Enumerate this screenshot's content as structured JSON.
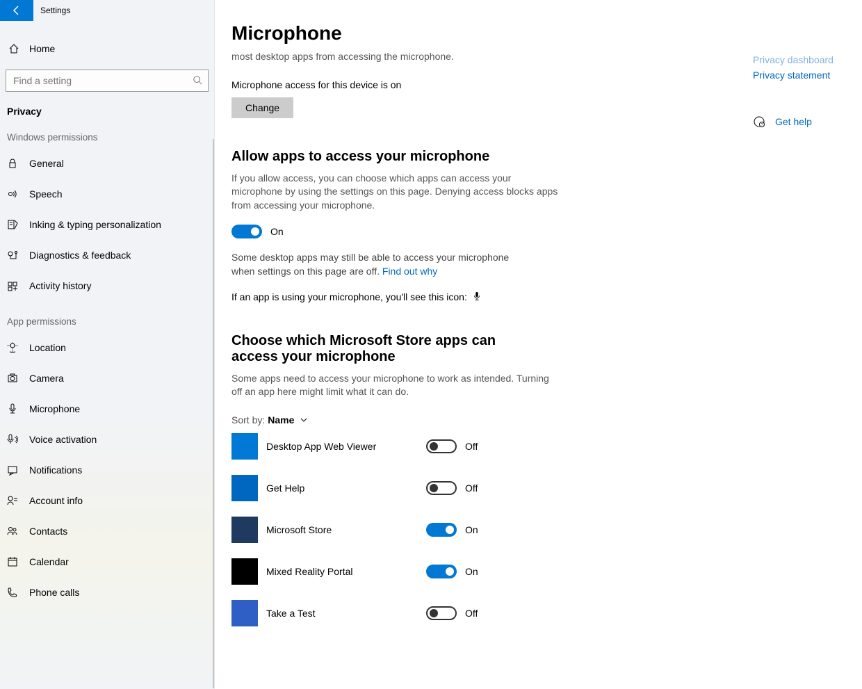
{
  "window": {
    "title": "Settings"
  },
  "sidebar": {
    "home": "Home",
    "search_placeholder": "Find a setting",
    "section": "Privacy",
    "group1": "Windows permissions",
    "group2": "App permissions",
    "items1": [
      {
        "label": "General"
      },
      {
        "label": "Speech"
      },
      {
        "label": "Inking & typing personalization"
      },
      {
        "label": "Diagnostics & feedback"
      },
      {
        "label": "Activity history"
      }
    ],
    "items2": [
      {
        "label": "Location"
      },
      {
        "label": "Camera"
      },
      {
        "label": "Microphone"
      },
      {
        "label": "Voice activation"
      },
      {
        "label": "Notifications"
      },
      {
        "label": "Account info"
      },
      {
        "label": "Contacts"
      },
      {
        "label": "Calendar"
      },
      {
        "label": "Phone calls"
      }
    ]
  },
  "page": {
    "title": "Microphone",
    "intro": "most desktop apps from accessing the microphone.",
    "device_status": "Microphone access for this device is on",
    "change_btn": "Change",
    "allow_heading": "Allow apps to access your microphone",
    "allow_desc": "If you allow access, you can choose which apps can access your microphone by using the settings on this page. Denying access blocks apps from accessing your microphone.",
    "allow_state": "On",
    "note1a": "Some desktop apps may still be able to access your microphone when settings on this page are off. ",
    "note1_link": "Find out why",
    "note2": "If an app is using your microphone, you'll see this icon:",
    "choose_heading": "Choose which Microsoft Store apps can access your microphone",
    "choose_desc": "Some apps need to access your microphone to work as intended. Turning off an app here might limit what it can do.",
    "sort_prefix": "Sort by:",
    "sort_value": "Name",
    "apps": [
      {
        "name": "Desktop App Web Viewer",
        "state": "Off",
        "on": false,
        "color": "#0078d4"
      },
      {
        "name": "Get Help",
        "state": "Off",
        "on": false,
        "color": "#0067c0"
      },
      {
        "name": "Microsoft Store",
        "state": "On",
        "on": true,
        "color": "#1f3a5f"
      },
      {
        "name": "Mixed Reality Portal",
        "state": "On",
        "on": true,
        "color": "#000"
      },
      {
        "name": "Take a Test",
        "state": "Off",
        "on": false,
        "color": "#2f5fc4"
      }
    ]
  },
  "right": {
    "link1": "Privacy dashboard",
    "link2": "Privacy statement",
    "help": "Get help"
  }
}
